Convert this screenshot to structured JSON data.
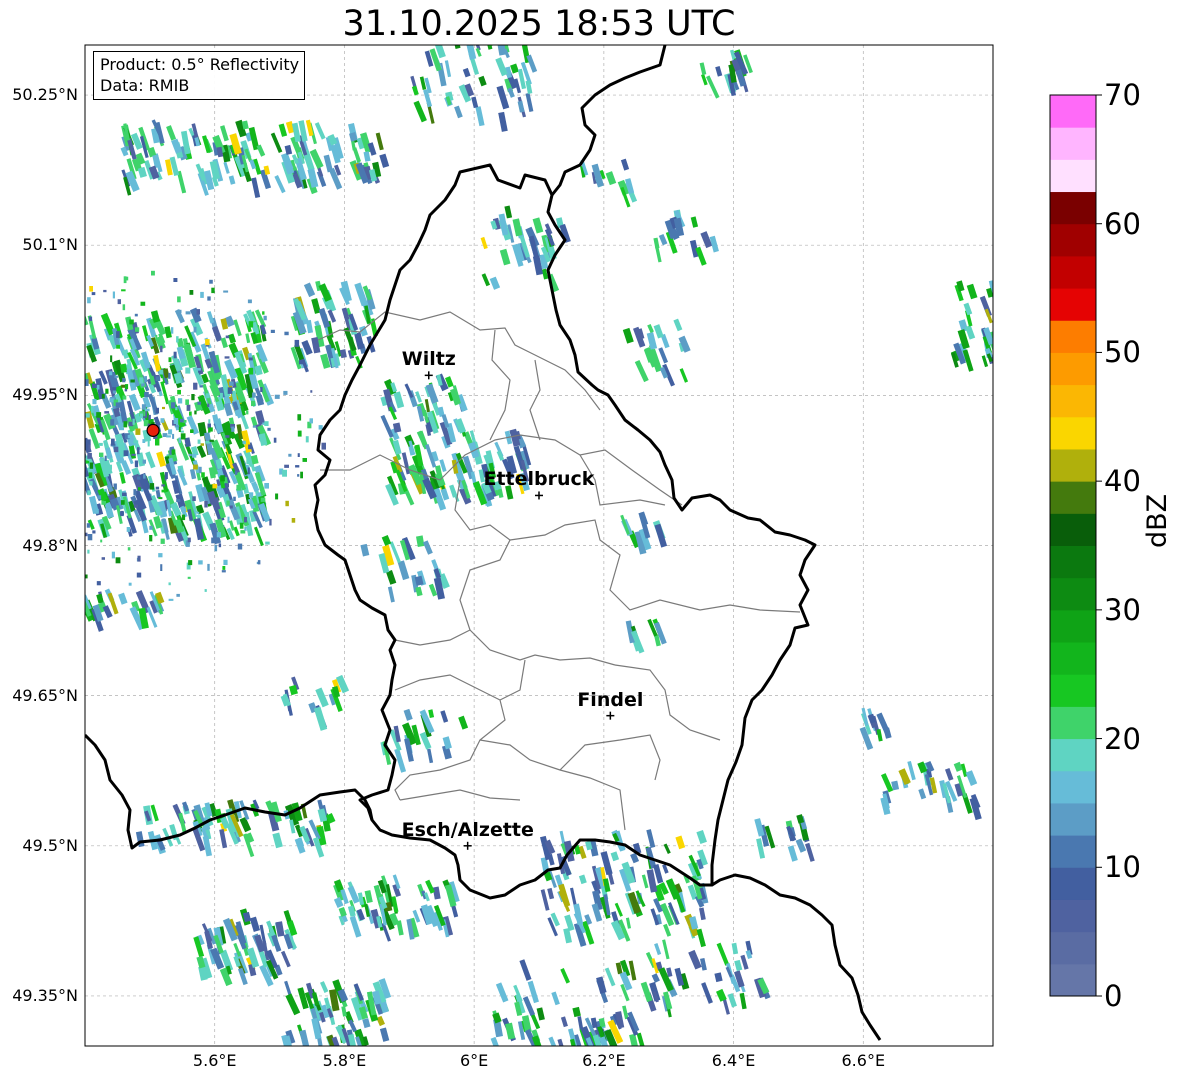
{
  "title": "31.10.2025 18:53 UTC",
  "info": {
    "product": "Product: 0.5° Reflectivity",
    "data": "Data: RMIB"
  },
  "axes": {
    "lat_ticks": [
      "50.25°N",
      "50.1°N",
      "49.95°N",
      "49.8°N",
      "49.65°N",
      "49.5°N",
      "49.35°N"
    ],
    "lon_ticks": [
      "5.6°E",
      "5.8°E",
      "6°E",
      "6.2°E",
      "6.4°E",
      "6.6°E"
    ],
    "lat_range": [
      49.3,
      50.3
    ],
    "lon_range": [
      5.4,
      6.8
    ],
    "grid": true
  },
  "cities": [
    {
      "name": "Wiltz",
      "lat": 49.97,
      "lon": 5.93
    },
    {
      "name": "Ettelbruck",
      "lat": 49.85,
      "lon": 6.1
    },
    {
      "name": "Findel",
      "lat": 49.63,
      "lon": 6.21
    },
    {
      "name": "Esch/Alzette",
      "lat": 49.5,
      "lon": 5.99
    }
  ],
  "radar_site": {
    "lat": 49.915,
    "lon": 5.505,
    "color": "#e8200c"
  },
  "colorbar": {
    "label": "dBZ",
    "ticks": [
      "70",
      "60",
      "50",
      "40",
      "30",
      "20",
      "10",
      "0"
    ],
    "min": 0,
    "max": 70,
    "step": 2.5,
    "colors": [
      "#6576a8",
      "#5a6ca3",
      "#4f62a0",
      "#425fa0",
      "#4a78b0",
      "#5c9dc6",
      "#66bcd8",
      "#5fd4c2",
      "#3fd36a",
      "#17c722",
      "#12b51c",
      "#0fa316",
      "#0d8b12",
      "#0b790f",
      "#095e0a",
      "#447a0d",
      "#b0b00c",
      "#fad600",
      "#fbb703",
      "#fd9b00",
      "#fd7d00",
      "#e50303",
      "#c20000",
      "#a00000",
      "#7a0000",
      "#ffe0ff",
      "#ffb5ff",
      "#ff6af8",
      "#e83ef0"
    ]
  },
  "map_colors": {
    "border": "#000000",
    "cantons": "#7a7a7a",
    "grid": "#b0b0b0"
  }
}
